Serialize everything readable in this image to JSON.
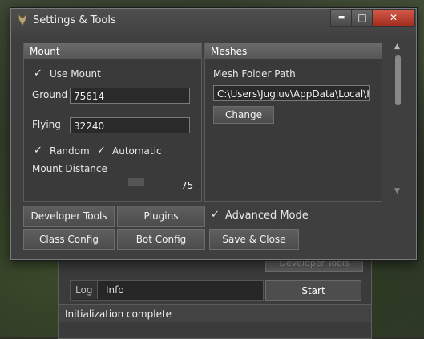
{
  "dialog": {
    "title": "Settings & Tools",
    "controls": {
      "minimize": "▬",
      "maximize": "□",
      "close": "✕"
    }
  },
  "mount": {
    "header": "Mount",
    "use_mount": {
      "label": "Use Mount",
      "checked": true
    },
    "ground": {
      "label": "Ground",
      "value": "75614"
    },
    "flying": {
      "label": "Flying",
      "value": "32240"
    },
    "random": {
      "label": "Random",
      "checked": true
    },
    "automatic": {
      "label": "Automatic",
      "checked": true
    },
    "distance": {
      "label": "Mount Distance",
      "value": "75"
    }
  },
  "meshes": {
    "header": "Meshes",
    "path_label": "Mesh Folder Path",
    "path_value": "C:\\Users\\Jugluv\\AppData\\Local\\Hon",
    "change_label": "Change"
  },
  "buttons": {
    "developer_tools": "Developer Tools",
    "plugins": "Plugins",
    "advanced_mode": {
      "label": "Advanced Mode",
      "checked": true
    },
    "class_config": "Class Config",
    "bot_config": "Bot Config",
    "save_close": "Save & Close"
  },
  "background_app": {
    "developer_tools": "Developer Tools",
    "log_tab": "Log",
    "info_tab": "Info",
    "start": "Start",
    "status": "Initialization complete"
  },
  "colors": {
    "close_button": "#c0392b",
    "panel_header": "#5e5e5e"
  }
}
